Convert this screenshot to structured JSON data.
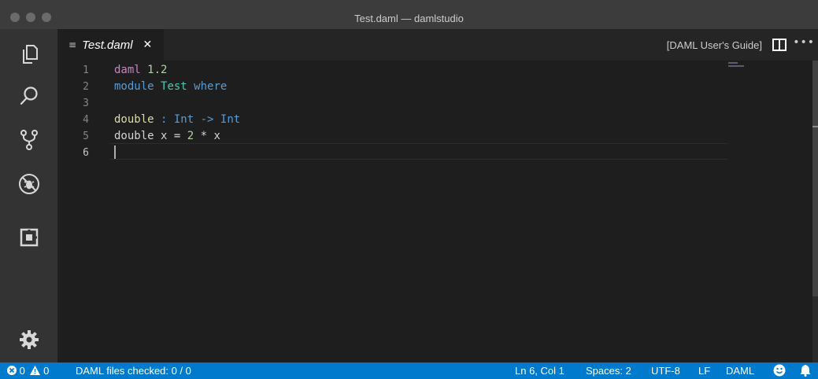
{
  "window": {
    "title": "Test.daml — damlstudio"
  },
  "activity_bar": {
    "items": [
      {
        "name": "explorer-icon"
      },
      {
        "name": "search-icon"
      },
      {
        "name": "source-control-icon"
      },
      {
        "name": "debug-icon"
      },
      {
        "name": "extensions-icon"
      }
    ],
    "manage": {
      "name": "gear-icon"
    }
  },
  "tabs": [
    {
      "label": "Test.daml",
      "close": "✕",
      "icon": "lines-icon"
    }
  ],
  "editor_actions": {
    "guide_label": "[DAML User's Guide]",
    "split_icon": "split-editor-icon",
    "more_label": "•••"
  },
  "editor": {
    "line_numbers": [
      "1",
      "2",
      "3",
      "4",
      "5",
      "6"
    ],
    "lines": {
      "l1": {
        "kw": "daml",
        "num": "1.2"
      },
      "l2": {
        "kw": "module",
        "name": "Test",
        "where": "where"
      },
      "l4": {
        "fn": "double",
        "sep": " : ",
        "t1": "Int",
        "arrow": " -> ",
        "t2": "Int"
      },
      "l5": {
        "a": "double x = ",
        "n": "2",
        "b": " * x"
      }
    },
    "active_line": "6"
  },
  "colors": {
    "status_bar": "#007acc",
    "keyword": "#c586c0",
    "number": "#b5cea8",
    "type": "#4ec9b0",
    "function": "#dcdcaa",
    "blue": "#569cd6"
  },
  "status_bar": {
    "errors": "0",
    "warnings": "0",
    "daml_check": "DAML files checked: 0 / 0",
    "position": "Ln 6, Col 1",
    "spaces": "Spaces: 2",
    "encoding": "UTF-8",
    "eol": "LF",
    "language": "DAML",
    "feedback_icon": "smiley-icon",
    "notifications_icon": "bell-icon"
  }
}
